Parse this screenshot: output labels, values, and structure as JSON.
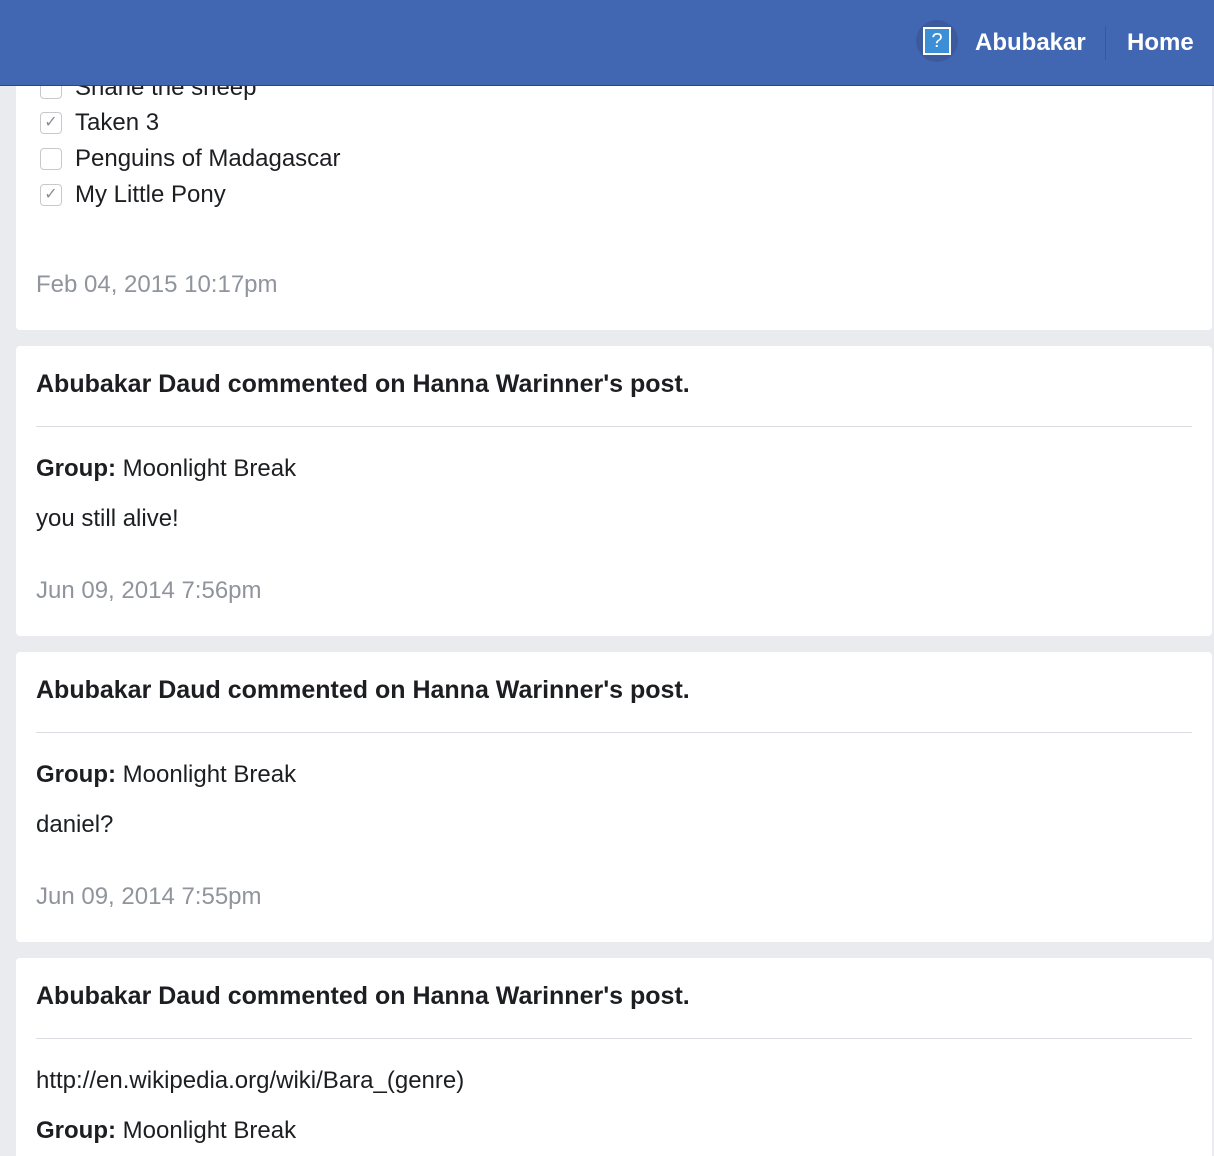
{
  "topbar": {
    "avatar_icon": "question-mark-icon",
    "user_name": "Abubakar",
    "home_label": "Home",
    "bg_color": "#4267b2"
  },
  "poll": {
    "options": [
      {
        "label": "Shane the sheep",
        "checked": false
      },
      {
        "label": "Taken 3",
        "checked": true
      },
      {
        "label": "Penguins of Madagascar",
        "checked": false
      },
      {
        "label": "My Little Pony",
        "checked": true
      }
    ],
    "timestamp": "Feb 04, 2015 10:17pm"
  },
  "posts": [
    {
      "title": "Abubakar Daud commented on Hanna Warinner's post.",
      "group_label": "Group:",
      "group_name": "Moonlight Break",
      "message": "you still alive!",
      "timestamp": "Jun 09, 2014 7:56pm"
    },
    {
      "title": "Abubakar Daud commented on Hanna Warinner's post.",
      "group_label": "Group:",
      "group_name": "Moonlight Break",
      "message": "daniel?",
      "timestamp": "Jun 09, 2014 7:55pm"
    },
    {
      "title": "Abubakar Daud commented on Hanna Warinner's post.",
      "link": "http://en.wikipedia.org/wiki/Bara_(genre)",
      "group_label": "Group:",
      "group_name": "Moonlight Break"
    }
  ]
}
